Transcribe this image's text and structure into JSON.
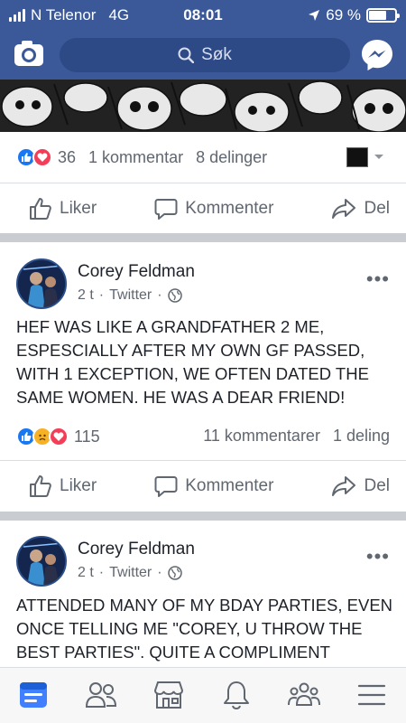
{
  "status_bar": {
    "carrier": "N Telenor",
    "network": "4G",
    "time": "08:01",
    "battery": "69 %",
    "battery_level": 0.69
  },
  "search": {
    "placeholder": "Søk",
    "icon": "search-icon"
  },
  "header_icons": {
    "left": "camera-icon",
    "right": "messenger-icon"
  },
  "colors": {
    "brand": "#3b5998",
    "like": "#1877f2",
    "love": "#f33e58",
    "sad": "#f7b125"
  },
  "post0": {
    "reaction_count": "36",
    "comments": "1 kommentar",
    "shares": "8 delinger"
  },
  "actions": {
    "like": "Liker",
    "comment": "Kommenter",
    "share": "Del"
  },
  "posts": [
    {
      "author": "Corey Feldman",
      "time": "2 t",
      "source": "Twitter",
      "text": "HEF WAS LIKE A GRANDFATHER 2 ME, ESPESCIALLY AFTER MY OWN GF PASSED, WITH 1 EXCEPTION, WE OFTEN DATED THE SAME WOMEN. HE WAS A DEAR FRIEND!",
      "reaction_count": "115",
      "comments": "11 kommentarer",
      "shares": "1 deling"
    },
    {
      "author": "Corey Feldman",
      "time": "2 t",
      "source": "Twitter",
      "text": "ATTENDED MANY OF MY BDAY PARTIES, EVEN ONCE TELLING ME \"COREY, U THROW THE BEST PARTIES\". QUITE A COMPLIMENT"
    }
  ],
  "bottom_nav": [
    "news-feed-icon",
    "friends-icon",
    "marketplace-icon",
    "notifications-icon",
    "groups-icon",
    "menu-icon"
  ]
}
